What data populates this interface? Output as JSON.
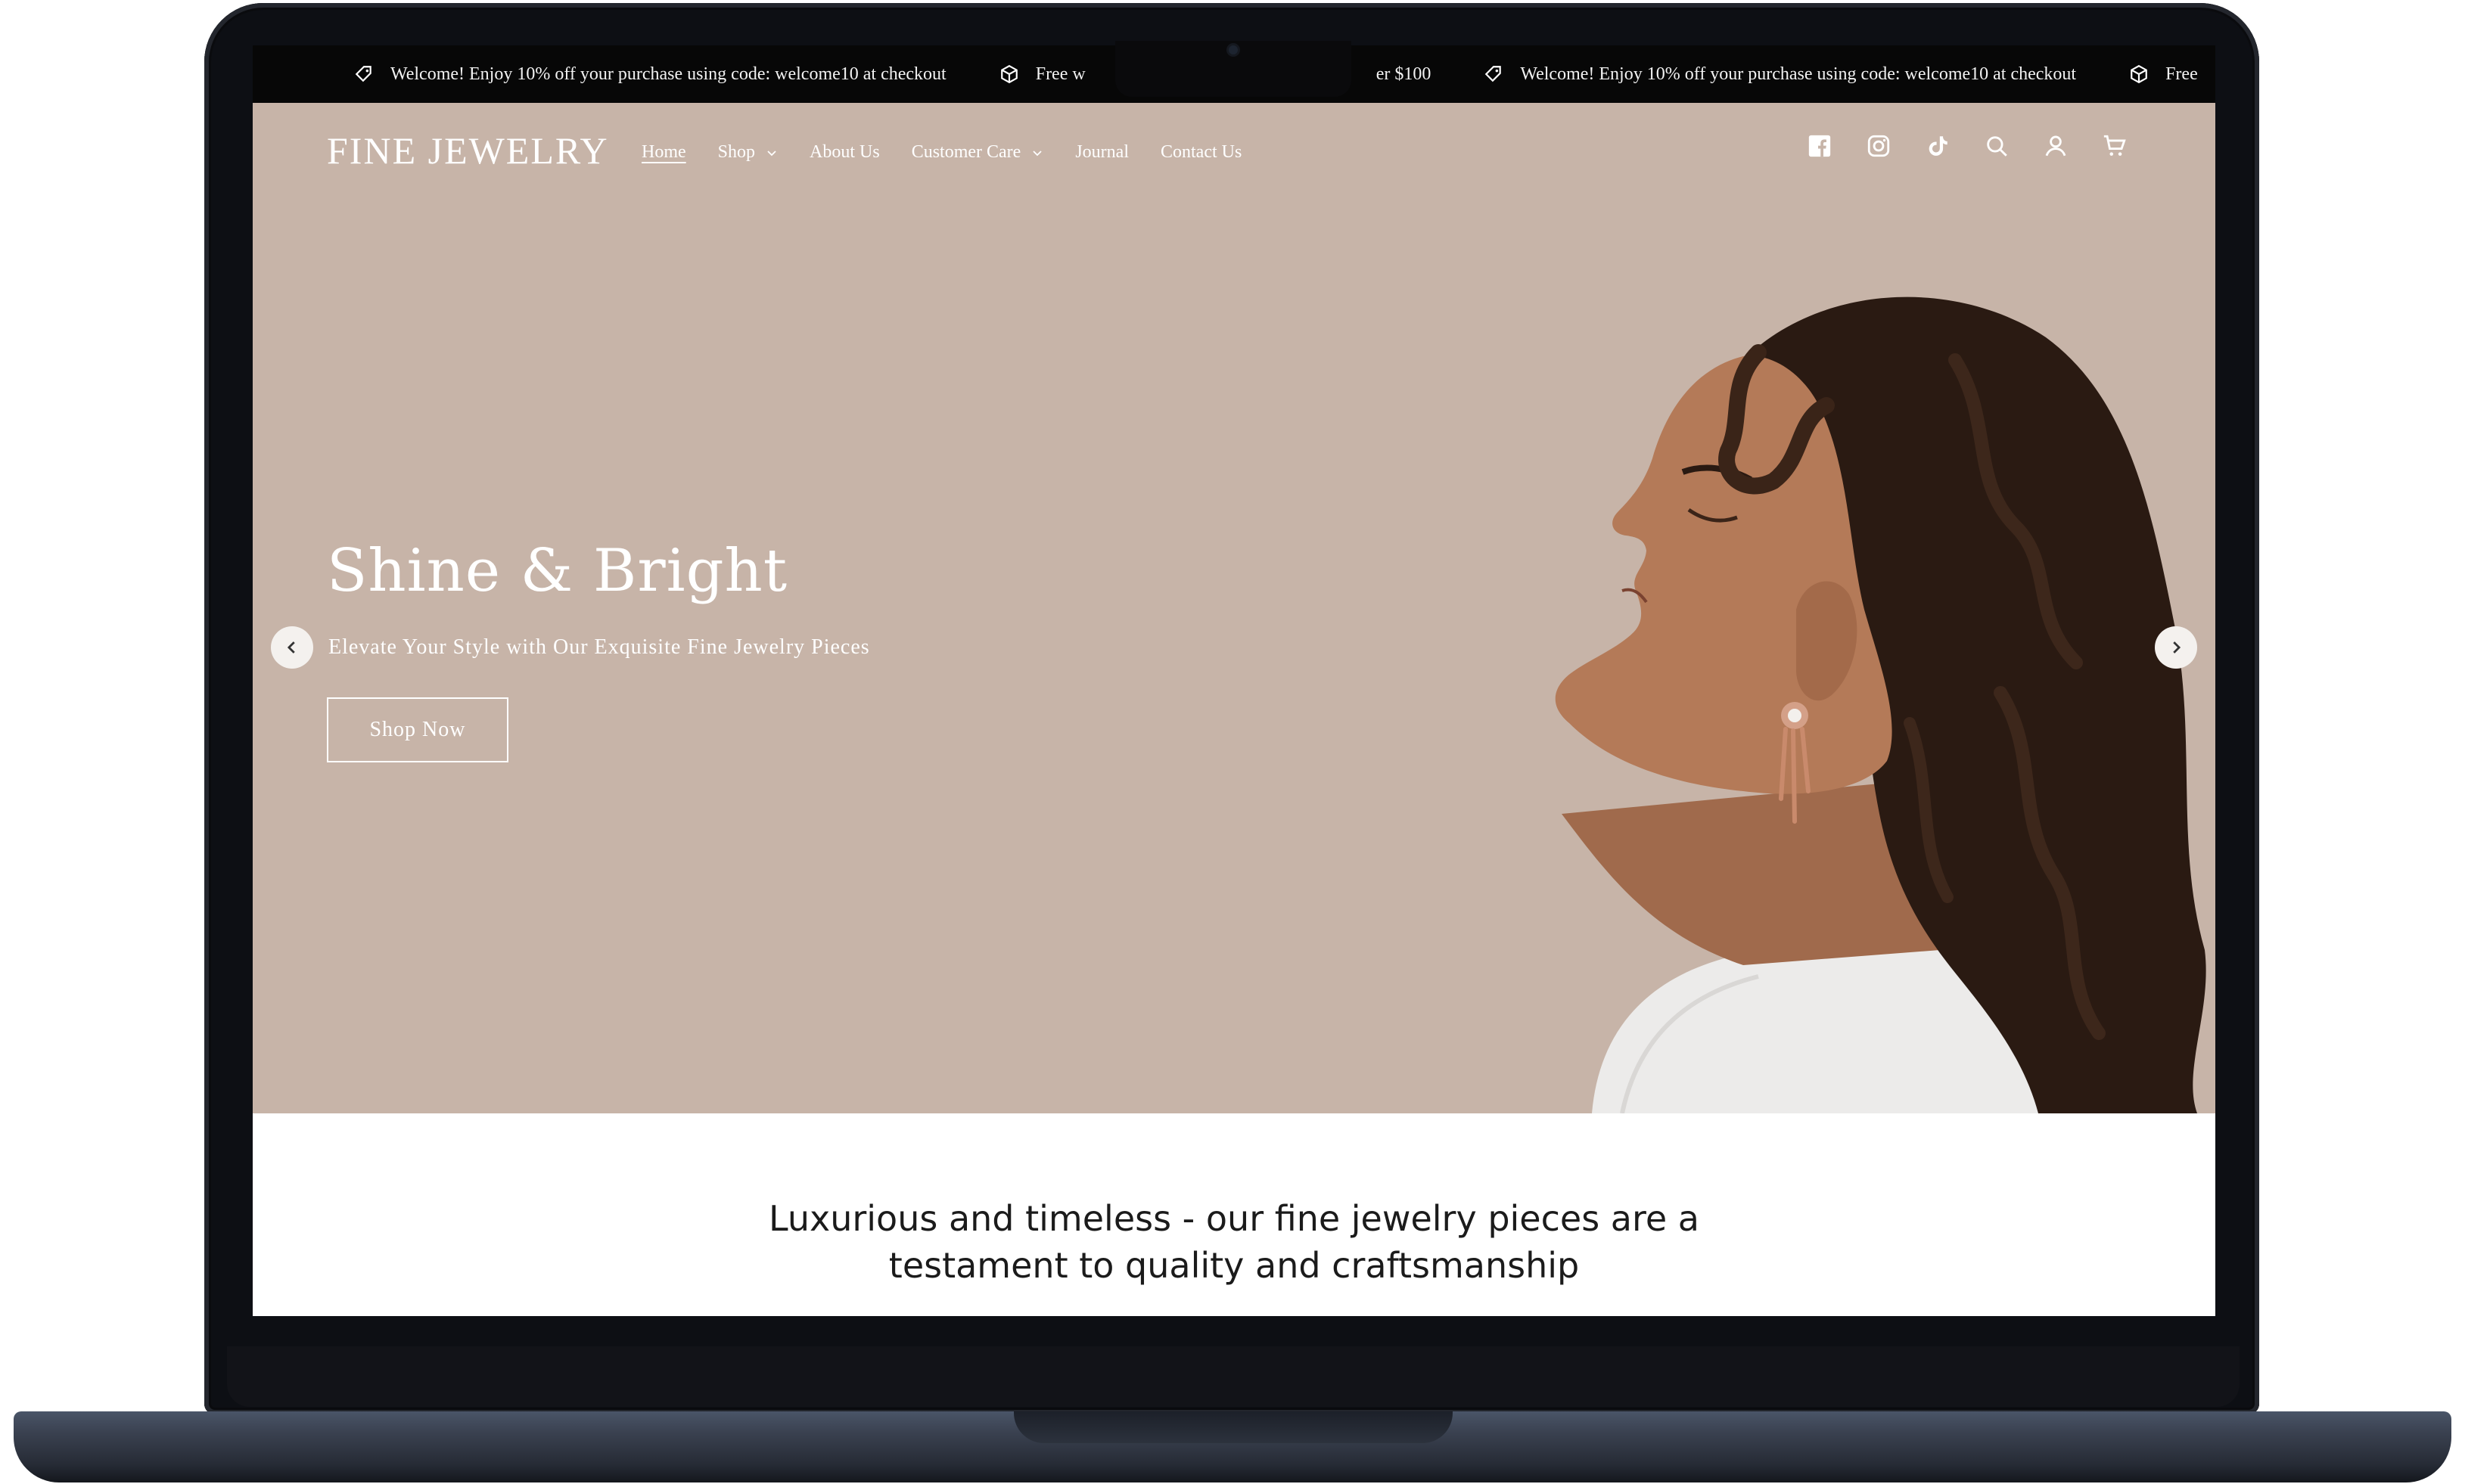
{
  "announcement_bar": {
    "items": [
      {
        "icon": "tag-icon",
        "text": "Welcome! Enjoy 10% off your purchase using code: welcome10 at checkout"
      },
      {
        "icon": "box-icon",
        "text": "Free w"
      },
      {
        "icon": "none",
        "text": "er $100"
      },
      {
        "icon": "tag-icon",
        "text": "Welcome! Enjoy 10% off your purchase using code: welcome10 at checkout"
      },
      {
        "icon": "box-icon",
        "text": "Free"
      }
    ]
  },
  "header": {
    "logo": "FINE JEWELRY",
    "nav": [
      {
        "label": "Home",
        "active": true,
        "dropdown": false
      },
      {
        "label": "Shop",
        "active": false,
        "dropdown": true
      },
      {
        "label": "About Us",
        "active": false,
        "dropdown": false
      },
      {
        "label": "Customer Care",
        "active": false,
        "dropdown": true
      },
      {
        "label": "Journal",
        "active": false,
        "dropdown": false
      },
      {
        "label": "Contact Us",
        "active": false,
        "dropdown": false
      }
    ],
    "icons": [
      "facebook-icon",
      "instagram-icon",
      "tiktok-icon",
      "search-icon",
      "account-icon",
      "cart-icon"
    ]
  },
  "hero": {
    "title": "Shine & Bright",
    "subtitle": "Elevate Your Style with Our Exquisite Fine Jewelry Pieces",
    "cta": "Shop Now",
    "background_color": "#c7b4a8"
  },
  "intro": {
    "line1": "Luxurious and timeless - our fine jewelry pieces are a",
    "line2": "testament to quality and craftsmanship"
  }
}
